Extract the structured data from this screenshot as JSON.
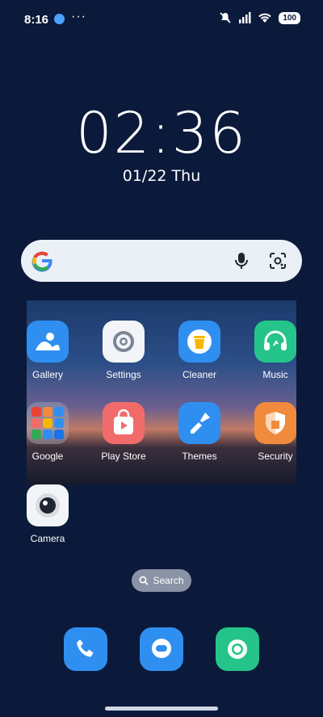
{
  "status_bar": {
    "time": "8:16",
    "more": "···",
    "battery": "100"
  },
  "clock": {
    "time": "02:36",
    "date": "01/22 Thu"
  },
  "apps": [
    {
      "label": "Gallery",
      "icon": "gallery-icon",
      "color": "#2f8ff0"
    },
    {
      "label": "Settings",
      "icon": "settings-icon",
      "color": "#f2f4f7"
    },
    {
      "label": "Cleaner",
      "icon": "cleaner-icon",
      "color": "#2f8ff0"
    },
    {
      "label": "Music",
      "icon": "music-icon",
      "color": "#25c48a"
    },
    {
      "label": "Google",
      "icon": "folder-icon",
      "color": "#8a93a6"
    },
    {
      "label": "Play Store",
      "icon": "play-store-icon",
      "color": "#f26b6b"
    },
    {
      "label": "Themes",
      "icon": "themes-icon",
      "color": "#2f8ff0"
    },
    {
      "label": "Security",
      "icon": "security-icon",
      "color": "#f08a3c"
    },
    {
      "label": "Camera",
      "icon": "camera-icon",
      "color": "#f2f4f7"
    }
  ],
  "search_pill": {
    "label": "Search"
  },
  "dock": [
    {
      "name": "phone-icon",
      "color": "#2f8ff0"
    },
    {
      "name": "messages-icon",
      "color": "#2f8ff0"
    },
    {
      "name": "chrome-icon",
      "color": "#25c48a"
    }
  ]
}
